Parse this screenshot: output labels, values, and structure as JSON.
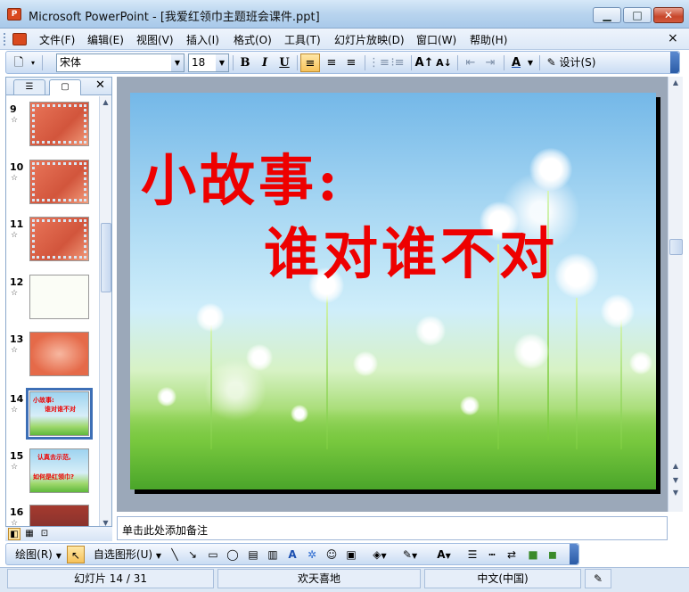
{
  "window": {
    "title": "Microsoft PowerPoint - [我爱红领巾主题班会课件.ppt]",
    "app_icon_label": "P",
    "minimize": "▁",
    "maximize": "□",
    "close": "✕"
  },
  "menu": {
    "items": [
      "文件(F)",
      "编辑(E)",
      "视图(V)",
      "插入(I)",
      "格式(O)",
      "工具(T)",
      "幻灯片放映(D)",
      "窗口(W)",
      "帮助(H)"
    ],
    "close": "×"
  },
  "toolbar": {
    "font_name": "宋体",
    "font_size": "18",
    "bold": "B",
    "italic": "I",
    "underline": "U",
    "design_label": "设计(S)"
  },
  "left_pane": {
    "tab_outline": "☰",
    "tab_slides": "▢",
    "close": "✕",
    "slides": [
      {
        "num": "9"
      },
      {
        "num": "10"
      },
      {
        "num": "11"
      },
      {
        "num": "12"
      },
      {
        "num": "13"
      },
      {
        "num": "14",
        "line1": "小故事:",
        "line2": "谁对谁不对"
      },
      {
        "num": "15",
        "line1": "认真去示范,",
        "line2": "如何是红领巾?"
      },
      {
        "num": "16"
      }
    ],
    "star": "☆"
  },
  "slide": {
    "title_line1": "小故事:",
    "title_line2": "谁对谁不对"
  },
  "notes": {
    "placeholder": "单击此处添加备注"
  },
  "drawing_toolbar": {
    "draw_menu": "绘图(R)",
    "autoshapes": "自选图形(U)"
  },
  "status": {
    "slide_info": "幻灯片 14 / 31",
    "design_name": "欢天喜地",
    "language": "中文(中国)"
  },
  "colors": {
    "accent": "#3d6fb6",
    "title_red": "#ee0000"
  }
}
